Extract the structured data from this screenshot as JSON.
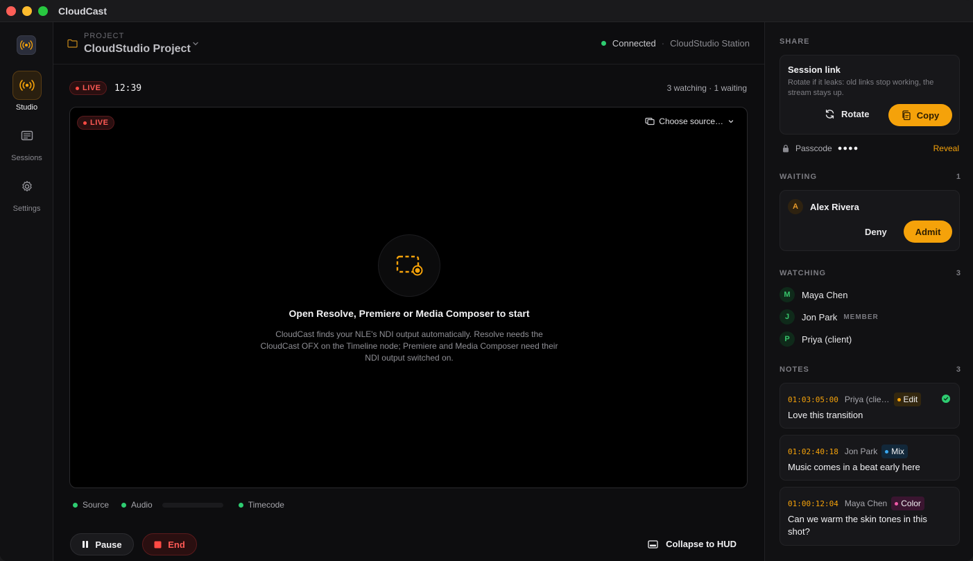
{
  "app": {
    "title": "CloudCast"
  },
  "nav": {
    "items": [
      {
        "label": "Studio",
        "icon": "broadcast-icon",
        "active": true
      },
      {
        "label": "Sessions",
        "icon": "sessions-icon",
        "active": false
      },
      {
        "label": "Settings",
        "icon": "gear-icon",
        "active": false
      }
    ]
  },
  "project": {
    "label": "PROJECT",
    "name": "CloudStudio Project",
    "connection": "Connected",
    "separator": "·",
    "station": "CloudStudio Station"
  },
  "stream": {
    "live_label": "LIVE",
    "timer": "12:39",
    "audience": "3 watching · 1 waiting",
    "choose_source": "Choose source…",
    "empty_title": "Open Resolve, Premiere or Media Composer to start",
    "empty_desc": "CloudCast finds your NLE's NDI output automatically. Resolve needs the CloudCast OFX on the Timeline node; Premiere and Media Composer need their NDI output switched on.",
    "status": {
      "source": "Source",
      "audio": "Audio",
      "timecode": "Timecode"
    },
    "pause_label": "Pause",
    "end_label": "End",
    "collapse_label": "Collapse to HUD"
  },
  "share": {
    "section": "SHARE",
    "session_title": "Session link",
    "session_desc": "Rotate if it leaks: old links stop working, the stream stays up.",
    "rotate_label": "Rotate",
    "copy_label": "Copy",
    "passcode_label": "Passcode",
    "passcode_mask": "●●●●",
    "reveal_label": "Reveal"
  },
  "waiting": {
    "section": "WAITING",
    "count": "1",
    "person": {
      "initial": "A",
      "name": "Alex Rivera"
    },
    "deny_label": "Deny",
    "admit_label": "Admit"
  },
  "watching": {
    "section": "WATCHING",
    "count": "3",
    "people": [
      {
        "initial": "M",
        "name": "Maya Chen",
        "tag": ""
      },
      {
        "initial": "J",
        "name": "Jon Park",
        "tag": "MEMBER"
      },
      {
        "initial": "P",
        "name": "Priya (client)",
        "tag": ""
      }
    ]
  },
  "notes": {
    "section": "NOTES",
    "count": "3",
    "items": [
      {
        "timecode": "01:03:05:00",
        "author": "Priya (clie…",
        "tag": "Edit",
        "body": "Love this transition",
        "resolved": true
      },
      {
        "timecode": "01:02:40:18",
        "author": "Jon Park",
        "tag": "Mix",
        "body": "Music comes in a beat early here",
        "resolved": false
      },
      {
        "timecode": "01:00:12:04",
        "author": "Maya Chen",
        "tag": "Color",
        "body": "Can we warm the skin tones in this shot?",
        "resolved": false
      }
    ]
  },
  "colors": {
    "accent": "#f5a20a",
    "live": "#ff5a55",
    "ok": "#2ecc71"
  }
}
